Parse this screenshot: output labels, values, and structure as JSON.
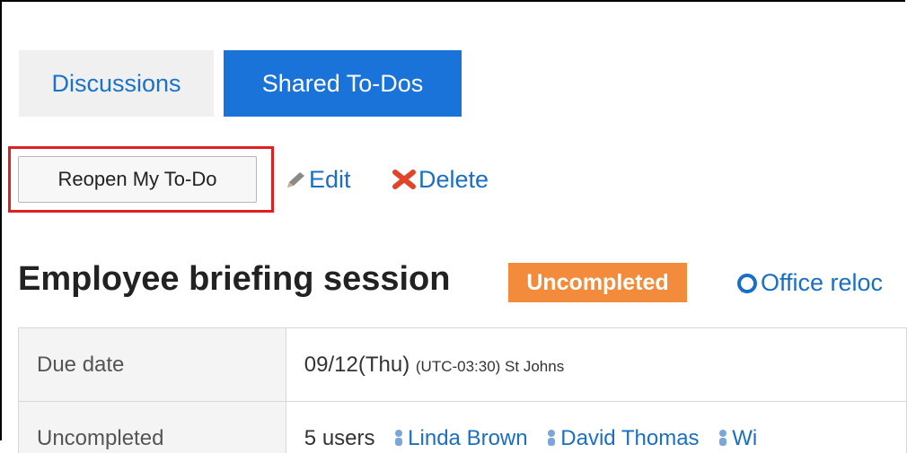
{
  "tabs": {
    "discussions": "Discussions",
    "shared_todos": "Shared To-Dos"
  },
  "toolbar": {
    "reopen_label": "Reopen My To-Do",
    "edit_label": "Edit",
    "delete_label": "Delete",
    "edit_icon": "pencil-icon",
    "delete_icon": "x-icon"
  },
  "todo": {
    "title": "Employee briefing session",
    "status": "Uncompleted",
    "related_link": "Office reloc"
  },
  "details": {
    "due_label": "Due date",
    "due_value": "09/12(Thu)",
    "due_tz": "(UTC-03:30) St Johns",
    "uncompleted_label": "Uncompleted",
    "uncompleted_count": "5 users",
    "users": [
      "Linda Brown",
      "David Thomas",
      "Wi"
    ]
  },
  "colors": {
    "accent": "#1a73d8",
    "link": "#1a6fc4",
    "status": "#f28c3c",
    "highlight": "#e01f1f"
  }
}
